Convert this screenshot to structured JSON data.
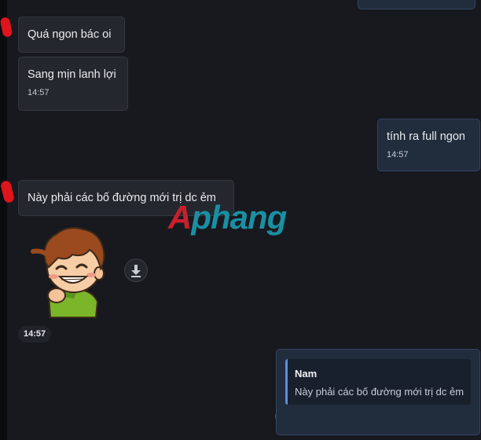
{
  "messages": {
    "m1": {
      "text": "Quá ngon bác oi"
    },
    "m2": {
      "text": "Sang mịn lanh lợi",
      "time": "14:57"
    },
    "m3": {
      "text": "tính ra full ngon",
      "time": "14:57"
    },
    "m4": {
      "text": "Này phải các bố đường mới trị dc ẻm"
    },
    "sticker": {
      "time": "14:57"
    },
    "reply": {
      "quote_author": "Nam",
      "quote_text": "Này phải các bố đường mới trị dc ẻm"
    }
  },
  "watermark": {
    "text": "Aphang",
    "first_letter": "A",
    "rest": "phang"
  },
  "icons": {
    "download": "download-icon"
  },
  "colors": {
    "background": "#17191e",
    "incoming_bubble": "#24272d",
    "outgoing_bubble": "#212c3d",
    "quote_bar": "#5f8edb",
    "annotation_red": "#e0141b"
  }
}
